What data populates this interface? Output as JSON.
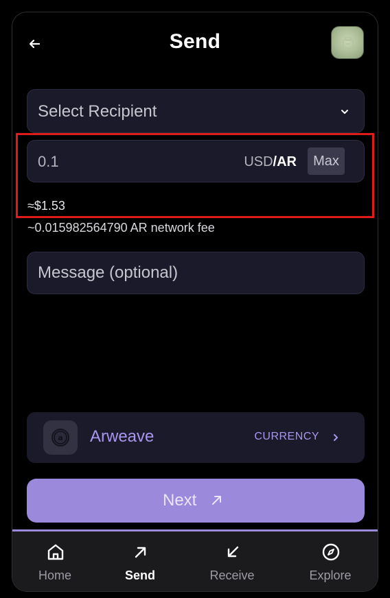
{
  "header": {
    "title": "Send",
    "back_icon": "arrow-left-icon",
    "avatar_icon": "wallet-avatar"
  },
  "recipient": {
    "placeholder": "Select Recipient",
    "icon": "chevron-down-icon"
  },
  "amount": {
    "value": "0.1",
    "unit_inactive": "USD",
    "unit_separator": "/",
    "unit_active": "AR",
    "max_label": "Max"
  },
  "fiat_estimate": "≈$1.53",
  "network_fee": "~0.015982564790 AR network fee",
  "message": {
    "placeholder": "Message (optional)"
  },
  "token": {
    "name": "Arweave",
    "currency_label": "CURRENCY",
    "icon": "arweave-logo-icon"
  },
  "next_button": {
    "label": "Next",
    "icon": "arrow-up-right-icon"
  },
  "nav": {
    "items": [
      {
        "label": "Home",
        "icon": "home-icon",
        "active": false
      },
      {
        "label": "Send",
        "icon": "arrow-up-right-icon",
        "active": true
      },
      {
        "label": "Receive",
        "icon": "arrow-down-left-icon",
        "active": false
      },
      {
        "label": "Explore",
        "icon": "compass-icon",
        "active": false
      }
    ]
  },
  "colors": {
    "accent": "#9b89dc",
    "accent_text": "#a996ee",
    "field_bg": "#1b1a2a",
    "highlight": "#e11a1a",
    "background": "#000000"
  }
}
